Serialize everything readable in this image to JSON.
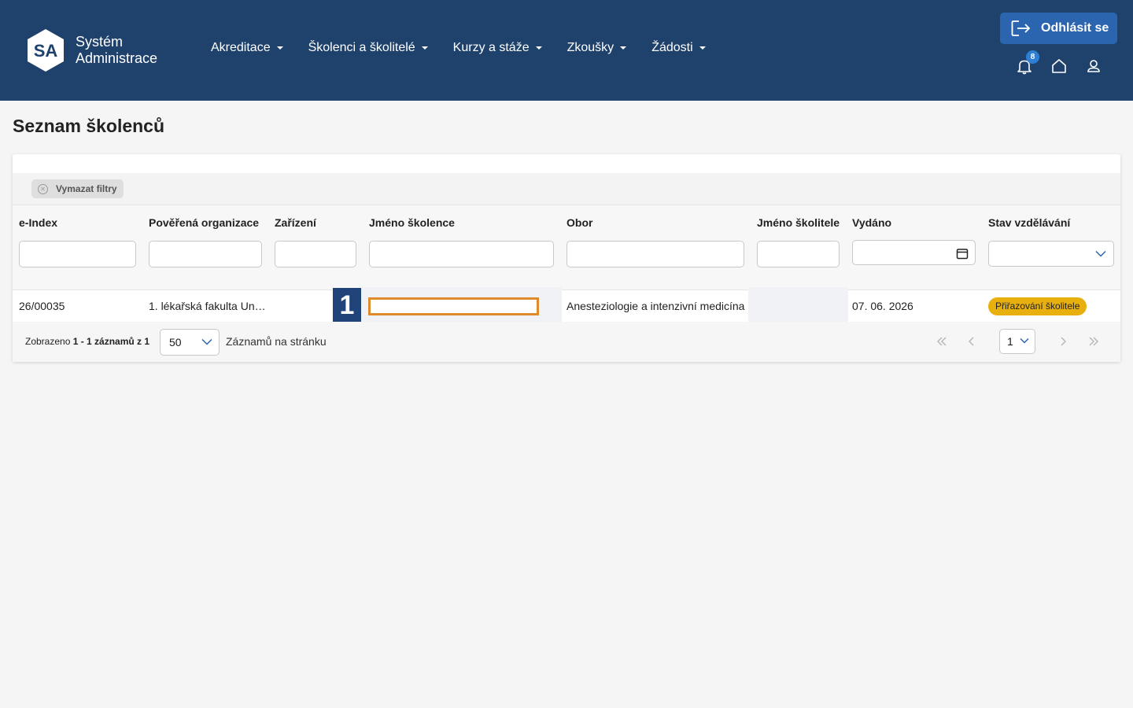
{
  "header": {
    "logo_abbr": "SA",
    "logo_line1": "Systém",
    "logo_line2": "Administrace",
    "nav": [
      "Akreditace",
      "Školenci a školitelé",
      "Kurzy a stáže",
      "Zkoušky",
      "Žádosti"
    ],
    "logout_label": "Odhlásit se",
    "notification_count": "8",
    "icons": [
      "bell-icon",
      "home-icon",
      "user-icon",
      "logout-icon"
    ]
  },
  "page": {
    "title": "Seznam školenců"
  },
  "filters": {
    "clear_label": "Vymazat filtry"
  },
  "table": {
    "columns": [
      "e-Index",
      "Pověřená organizace",
      "Zařízení",
      "Jméno školence",
      "Obor",
      "Jméno školitele",
      "Vydáno",
      "Stav vzdělávání"
    ],
    "rows": [
      {
        "eindex": "26/00035",
        "organizace": "1. lékařská fakulta Un…",
        "zarizeni": "",
        "jmeno_skolence": "",
        "obor": "Anesteziologie a intenzivní medicína",
        "jmeno_skolitele": "",
        "vydano": "07. 06. 2026",
        "stav": "Přiřazování školitele"
      }
    ],
    "marker_number": "1"
  },
  "footer": {
    "shown_prefix": "Zobrazeno ",
    "shown_range": "1 - 1 záznamů z 1",
    "per_page_value": "50",
    "per_page_label": "Záznamů na stránku",
    "current_page": "1"
  },
  "colors": {
    "header_bg": "#1f426d",
    "logout_bg": "#2b65b0",
    "status_pill": "#e8b00e",
    "highlight_border": "#e08a2e",
    "marker_bg": "#20437a"
  }
}
